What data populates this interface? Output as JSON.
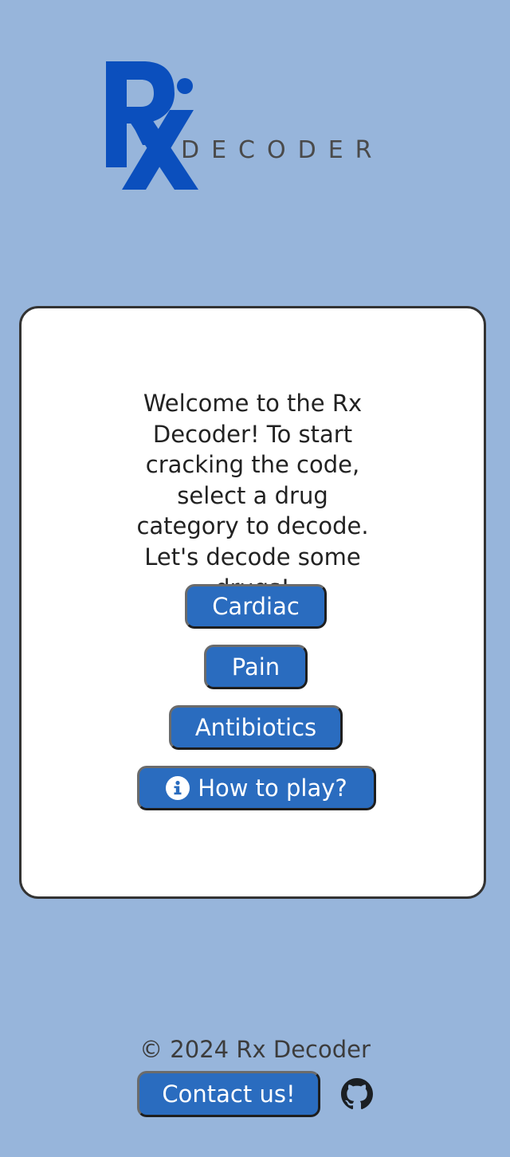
{
  "logo": {
    "mark": "Rx",
    "word": "DECODER",
    "mark_color": "#0b4fbd",
    "word_color": "#4a4a4a"
  },
  "welcome_text": "Welcome to the Rx Decoder! To start cracking the code, select a drug category to decode. Let's decode some drugs!",
  "categories": {
    "cardiac": "Cardiac",
    "pain": "Pain",
    "antibiotics": "Antibiotics"
  },
  "how_to_play": {
    "label": "How to play?",
    "icon": "info-circle-icon"
  },
  "footer": {
    "copyright": "© 2024 Rx Decoder",
    "contact_label": "Contact us!",
    "github_icon": "github-icon"
  },
  "colors": {
    "background": "#97b5db",
    "button": "#2a6cbf",
    "card": "#ffffff"
  }
}
